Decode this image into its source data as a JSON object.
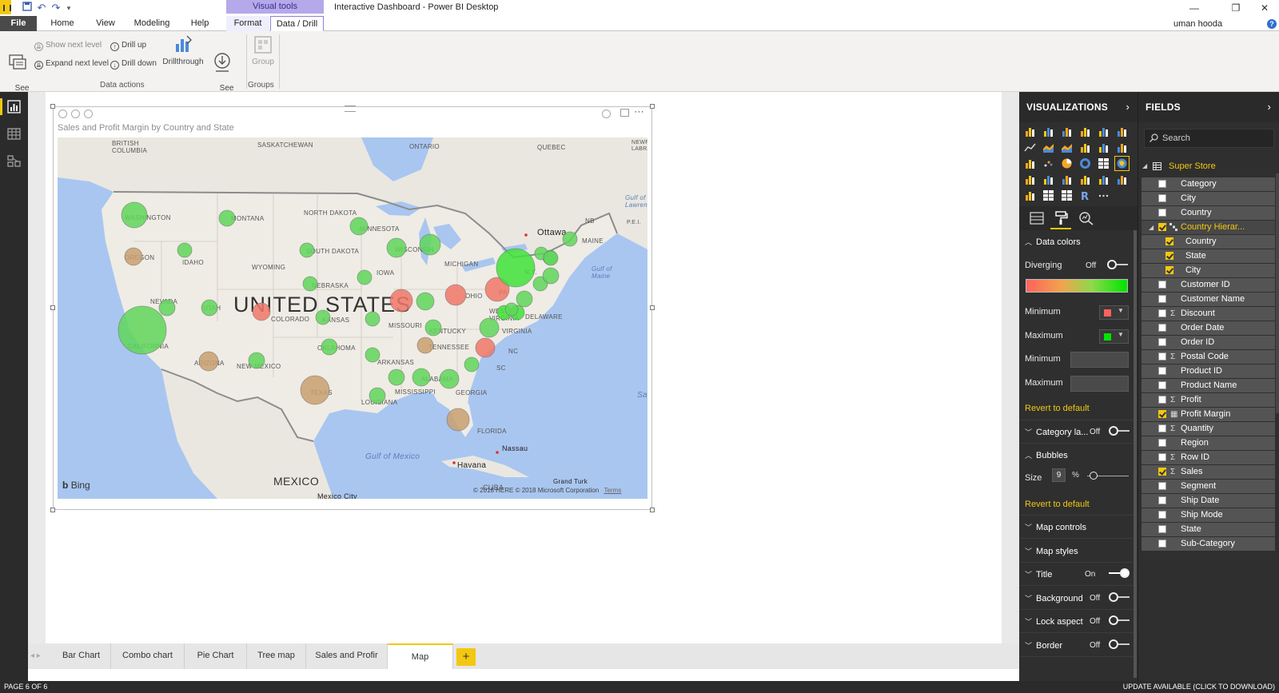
{
  "titlebar": {
    "contextual_group": "Visual tools",
    "window_title": "Interactive Dashboard - Power BI Desktop",
    "user": "uman hooda"
  },
  "ribbon_tabs": {
    "file": "File",
    "home": "Home",
    "view": "View",
    "modeling": "Modeling",
    "help": "Help",
    "format": "Format",
    "data_drill": "Data / Drill"
  },
  "ribbon": {
    "see_data": "See\nData",
    "show_next_level": "Show next level",
    "expand_next_level": "Expand next level",
    "drill_up": "Drill up",
    "drill_down": "Drill down",
    "drillthrough": "Drillthrough",
    "see_records": "See\nRecords",
    "group": "Group",
    "group_data_actions": "Data actions",
    "group_groups": "Groups"
  },
  "visual": {
    "title": "Sales and Profit Margin by Country and State",
    "bing": "Bing",
    "copyright": "© 2018 HERE © 2018 Microsoft Corporation",
    "terms": "Terms"
  },
  "map_labels": {
    "british_columbia": "BRITISH\nCOLUMBIA",
    "saskatchewan": "SASKATCHEWAN",
    "ontario": "ONTARIO",
    "quebec": "QUEBEC",
    "newfoundland": "NEWFOUND\nLABRA",
    "gulf_st_lawrence": "Gulf of St.\nLawrence",
    "nb": "NB",
    "pei": "P.E.I.",
    "north_dakota": "NORTH DAKOTA",
    "montana": "MONTANA",
    "washington": "WASHINGTON",
    "oregon": "OREGON",
    "idaho": "IDAHO",
    "wyoming": "WYOMING",
    "south_dakota": "SOUTH DAKOTA",
    "minnesota": "MINNESOTA",
    "wisconsin": "WISCONSIN",
    "michigan": "MICHIGAN",
    "ottawa": "Ottawa",
    "maine": "MAINE",
    "gulf_maine": "Gulf of\nMaine",
    "ny": "N.Y.",
    "pa": "PA",
    "iowa": "IOWA",
    "nebraska": "NEBRASKA",
    "nevada": "NEVADA",
    "utah": "UTAH",
    "colorado": "COLORADO",
    "kansas": "KANSAS",
    "missouri": "MISSOURI",
    "ohio": "OHIO",
    "west_virginia": "WEST\nVIRGINIA",
    "delaware": "DELAWARE",
    "virginia": "VIRGINIA",
    "kentucky": "KENTUCKY",
    "tennessee": "TENNESSEE",
    "nc": "NC",
    "california": "CALIFORNIA",
    "arizona": "ARIZONA",
    "new_mexico": "NEW MEXICO",
    "oklahoma": "OKLAHOMA",
    "arkansas": "ARKANSAS",
    "sc": "SC",
    "mississippi": "MISSISSIPPI",
    "alabama": "ALABAMA",
    "georgia": "GEORGIA",
    "texas": "TEXAS",
    "louisiana": "LOUISIANA",
    "florida": "FLORIDA",
    "united_states": "UNITED STATES",
    "gulf_mexico": "Gulf of Mexico",
    "nassau": "Nassau",
    "havana": "Havana",
    "grand_turk": "Grand Turk",
    "cuba": "CUBA",
    "mexico": "MEXICO",
    "mexico_city": "Mexico City",
    "sargasso": "Sar"
  },
  "page_tabs": [
    "Bar Chart",
    "Combo chart",
    "Pie Chart",
    "Tree map",
    "Sales and Profir",
    "Map"
  ],
  "page_tab_add": "+",
  "status": {
    "page": "PAGE 6 OF 6",
    "update": "UPDATE AVAILABLE (CLICK TO DOWNLOAD)"
  },
  "visualizations": {
    "header": "VISUALIZATIONS",
    "data_colors": "Data colors",
    "diverging": "Diverging",
    "diverging_state": "Off",
    "minimum": "Minimum",
    "maximum": "Maximum",
    "minimum_color": "#fd625e",
    "maximum_color": "#00e400",
    "minimum_value": "Minimum",
    "maximum_value": "Maximum",
    "revert": "Revert to default",
    "category_labels": "Category la...",
    "category_labels_state": "Off",
    "bubbles": "Bubbles",
    "size": "Size",
    "size_value": "9",
    "size_unit": "%",
    "revert2": "Revert to default",
    "map_controls": "Map controls",
    "map_styles": "Map styles",
    "title": "Title",
    "title_state": "On",
    "background": "Background",
    "background_state": "Off",
    "lock_aspect": "Lock aspect",
    "lock_aspect_state": "Off",
    "border": "Border",
    "border_state": "Off"
  },
  "fields": {
    "header": "FIELDS",
    "search_placeholder": "Search",
    "table": "Super Store",
    "items": [
      {
        "name": "Category",
        "checked": false,
        "sigma": false
      },
      {
        "name": "City",
        "checked": false,
        "sigma": false
      },
      {
        "name": "Country",
        "checked": false,
        "sigma": false
      },
      {
        "name": "Country Hierar...",
        "checked": true,
        "sigma": false,
        "hierarchy": true
      },
      {
        "name": "Country",
        "checked": true,
        "sigma": false,
        "sub": true
      },
      {
        "name": "State",
        "checked": true,
        "sigma": false,
        "sub": true
      },
      {
        "name": "City",
        "checked": true,
        "sigma": false,
        "sub": true
      },
      {
        "name": "Customer ID",
        "checked": false,
        "sigma": false
      },
      {
        "name": "Customer Name",
        "checked": false,
        "sigma": false
      },
      {
        "name": "Discount",
        "checked": false,
        "sigma": true
      },
      {
        "name": "Order Date",
        "checked": false,
        "sigma": false
      },
      {
        "name": "Order ID",
        "checked": false,
        "sigma": false
      },
      {
        "name": "Postal Code",
        "checked": false,
        "sigma": true
      },
      {
        "name": "Product ID",
        "checked": false,
        "sigma": false
      },
      {
        "name": "Product Name",
        "checked": false,
        "sigma": false
      },
      {
        "name": "Profit",
        "checked": false,
        "sigma": true
      },
      {
        "name": "Profit Margin",
        "checked": true,
        "sigma": false,
        "calc": true
      },
      {
        "name": "Quantity",
        "checked": false,
        "sigma": true
      },
      {
        "name": "Region",
        "checked": false,
        "sigma": false
      },
      {
        "name": "Row ID",
        "checked": false,
        "sigma": true
      },
      {
        "name": "Sales",
        "checked": true,
        "sigma": true
      },
      {
        "name": "Segment",
        "checked": false,
        "sigma": false
      },
      {
        "name": "Ship Date",
        "checked": false,
        "sigma": false
      },
      {
        "name": "Ship Mode",
        "checked": false,
        "sigma": false
      },
      {
        "name": "State",
        "checked": false,
        "sigma": false
      },
      {
        "name": "Sub-Category",
        "checked": false,
        "sigma": false
      }
    ]
  },
  "bubble_colors": {
    "positive": "#5fd65a",
    "neutral": "#c9a070",
    "negative": "#f07868",
    "strong_positive": "#3fe23a"
  },
  "bubbles": [
    {
      "state": "Washington",
      "color": "positive",
      "size": 16
    },
    {
      "state": "Montana",
      "color": "positive",
      "size": 10
    },
    {
      "state": "Oregon",
      "color": "neutral",
      "size": 11
    },
    {
      "state": "Idaho",
      "color": "positive",
      "size": 9
    },
    {
      "state": "Nevada",
      "color": "positive",
      "size": 10
    },
    {
      "state": "California",
      "color": "positive",
      "size": 30
    },
    {
      "state": "Utah",
      "color": "positive",
      "size": 10
    },
    {
      "state": "Arizona",
      "color": "neutral",
      "size": 12
    },
    {
      "state": "Colorado",
      "color": "negative",
      "size": 11
    },
    {
      "state": "New Mexico",
      "color": "positive",
      "size": 10
    },
    {
      "state": "Texas",
      "color": "neutral",
      "size": 18
    },
    {
      "state": "South Dakota",
      "color": "positive",
      "size": 9
    },
    {
      "state": "Nebraska",
      "color": "positive",
      "size": 9
    },
    {
      "state": "Kansas",
      "color": "positive",
      "size": 9
    },
    {
      "state": "Oklahoma",
      "color": "positive",
      "size": 10
    },
    {
      "state": "Minnesota",
      "color": "positive",
      "size": 11
    },
    {
      "state": "Iowa",
      "color": "positive",
      "size": 9
    },
    {
      "state": "Missouri",
      "color": "positive",
      "size": 9
    },
    {
      "state": "Arkansas",
      "color": "positive",
      "size": 9
    },
    {
      "state": "Louisiana",
      "color": "positive",
      "size": 10
    },
    {
      "state": "Wisconsin",
      "color": "positive",
      "size": 12
    },
    {
      "state": "Illinois",
      "color": "negative",
      "size": 14
    },
    {
      "state": "Michigan",
      "color": "positive",
      "size": 13
    },
    {
      "state": "Indiana",
      "color": "positive",
      "size": 11
    },
    {
      "state": "Ohio",
      "color": "negative",
      "size": 13
    },
    {
      "state": "Kentucky",
      "color": "positive",
      "size": 10
    },
    {
      "state": "Tennessee",
      "color": "neutral",
      "size": 10
    },
    {
      "state": "Mississippi",
      "color": "positive",
      "size": 10
    },
    {
      "state": "Alabama",
      "color": "positive",
      "size": 11
    },
    {
      "state": "Georgia",
      "color": "positive",
      "size": 12
    },
    {
      "state": "South Carolina",
      "color": "positive",
      "size": 9
    },
    {
      "state": "North Carolina",
      "color": "negative",
      "size": 12
    },
    {
      "state": "Virginia",
      "color": "positive",
      "size": 12
    },
    {
      "state": "West Virginia",
      "color": "strong_positive",
      "size": 9
    },
    {
      "state": "Pennsylvania",
      "color": "negative",
      "size": 15
    },
    {
      "state": "New York",
      "color": "strong_positive",
      "size": 24
    },
    {
      "state": "New Jersey",
      "color": "positive",
      "size": 10
    },
    {
      "state": "Delaware",
      "color": "strong_positive",
      "size": 9
    },
    {
      "state": "Maryland",
      "color": "positive",
      "size": 8
    },
    {
      "state": "Connecticut",
      "color": "positive",
      "size": 9
    },
    {
      "state": "Massachusetts",
      "color": "positive",
      "size": 10
    },
    {
      "state": "Rhode Island",
      "color": "positive",
      "size": 9
    },
    {
      "state": "Vermont",
      "color": "positive",
      "size": 8
    },
    {
      "state": "New Hampshire",
      "color": "positive",
      "size": 9
    },
    {
      "state": "Maine",
      "color": "positive",
      "size": 9
    },
    {
      "state": "Florida",
      "color": "neutral",
      "size": 14
    }
  ]
}
